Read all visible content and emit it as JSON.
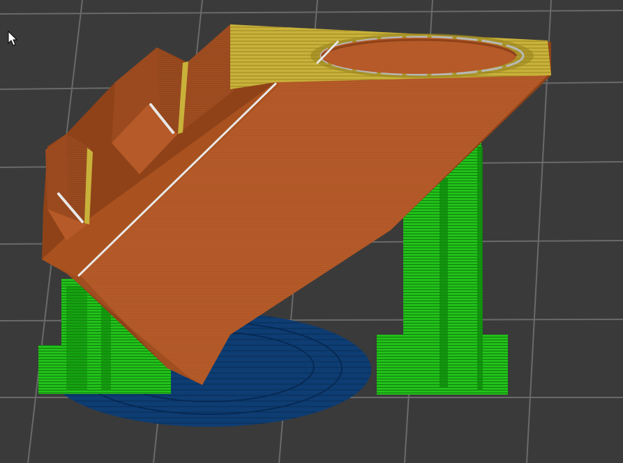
{
  "app": {
    "view": "3d-slice-preview"
  },
  "cursor": {
    "icon": "arrow-pointer-icon"
  },
  "scene": {
    "background_color": "#3a3a3a",
    "grid_color": "#6a6a6a",
    "model": {
      "name": "printed-part",
      "wall_color": "#b55a28",
      "wall_shadow_color": "#8f4218",
      "top_infill_color": "#c9b23a",
      "bridge_color": "#e8e8e8"
    },
    "supports": {
      "color": "#22c21a",
      "dark_color": "#0f8a0c"
    },
    "brim": {
      "color": "#0e3d73"
    }
  }
}
